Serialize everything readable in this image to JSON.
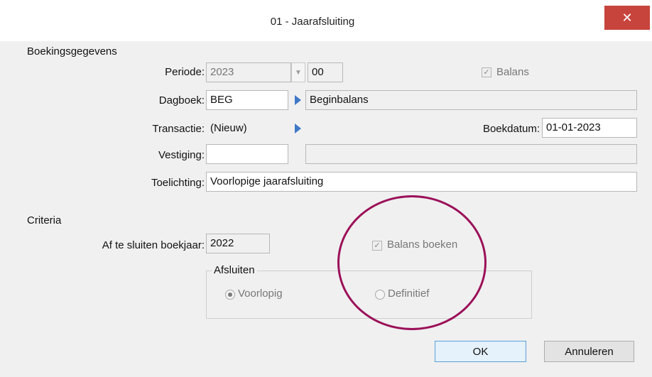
{
  "window": {
    "title": "01 - Jaarafsluiting",
    "close_glyph": "✕"
  },
  "boekingsgegevens": {
    "heading": "Boekingsgegevens",
    "periode": {
      "label": "Periode:",
      "year": "2023",
      "period": "00"
    },
    "balans": {
      "label": "Balans",
      "checked": true
    },
    "dagboek": {
      "label": "Dagboek:",
      "code": "BEG",
      "description": "Beginbalans"
    },
    "transactie": {
      "label": "Transactie:",
      "value": "(Nieuw)"
    },
    "boekdatum": {
      "label": "Boekdatum:",
      "value": "01-01-2023"
    },
    "vestiging": {
      "label": "Vestiging:",
      "code": "",
      "description": ""
    },
    "toelichting": {
      "label": "Toelichting:",
      "value": "Voorlopige jaarafsluiting"
    }
  },
  "criteria": {
    "heading": "Criteria",
    "boekjaar": {
      "label": "Af te sluiten boekjaar:",
      "value": "2022"
    },
    "balans_boeken": {
      "label": "Balans boeken",
      "checked": true
    },
    "afsluiten": {
      "legend": "Afsluiten",
      "options": [
        {
          "label": "Voorlopig",
          "selected": true
        },
        {
          "label": "Definitief",
          "selected": false
        }
      ]
    }
  },
  "buttons": {
    "ok": "OK",
    "cancel": "Annuleren"
  },
  "colors": {
    "annotation": "#9b1159",
    "close_bg": "#c7443c",
    "arrow": "#3f78c6"
  }
}
